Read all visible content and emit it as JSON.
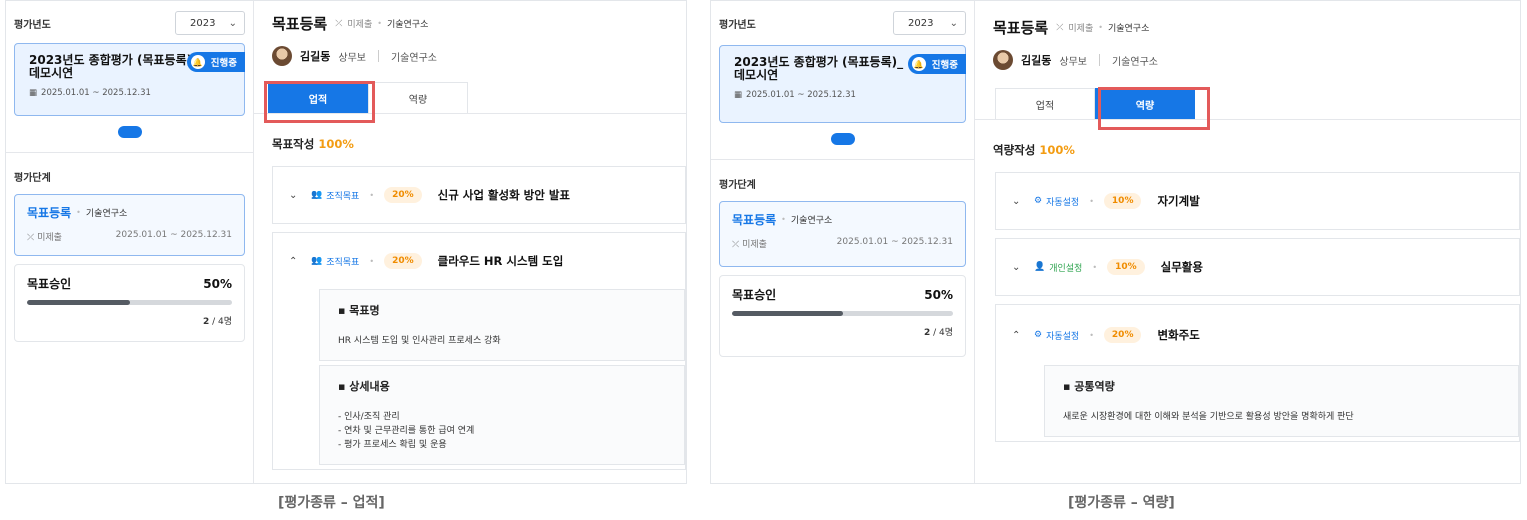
{
  "left": {
    "sidebar": {
      "year_label": "평가년도",
      "year_value": "2023",
      "eval_title": "2023년도 종합평가 (목표등록)_데모시연",
      "eval_badge": "진행중",
      "eval_period": "2025.01.01 ~ 2025.12.31",
      "stage_label": "평가단계",
      "stage_name": "목표등록",
      "stage_dept": "기술연구소",
      "stage_status": "미제출",
      "stage_period": "2025.01.01 ~ 2025.12.31",
      "approve_name": "목표승인",
      "approve_pct": "50%",
      "approve_progress": 0.5,
      "approve_done": "2",
      "approve_total": "/ 4명"
    },
    "main": {
      "title": "목표등록",
      "status": "미제출",
      "dept": "기술연구소",
      "user_name": "김길동",
      "user_rank": "상무보",
      "user_dept": "기술연구소",
      "tab1": "업적",
      "tab2": "역량",
      "section_title": "목표작성",
      "section_pct": "100%",
      "goals": [
        {
          "kind": "조직목표",
          "pct": "20%",
          "name": "신규 사업 활성화 방안 발표"
        },
        {
          "kind": "조직목표",
          "pct": "20%",
          "name": "클라우드 HR 시스템 도입"
        }
      ],
      "detail1_title": "목표명",
      "detail1_body": "HR 시스템 도입 및 인사관리 프로세스 강화",
      "detail2_title": "상세내용",
      "detail2_lines": [
        "- 인사/조직 관리",
        "- 연차 및 근무관리를 통한 급여 연계",
        "- 평가 프로세스 확립 및 운용"
      ]
    },
    "caption": "[평가종류 – 업적]"
  },
  "right": {
    "sidebar": {
      "year_label": "평가년도",
      "year_value": "2023",
      "eval_title": "2023년도 종합평가 (목표등록)_데모시연",
      "eval_badge": "진행중",
      "eval_period": "2025.01.01 ~ 2025.12.31",
      "stage_label": "평가단계",
      "stage_name": "목표등록",
      "stage_dept": "기술연구소",
      "stage_status": "미제출",
      "stage_period": "2025.01.01 ~ 2025.12.31",
      "approve_name": "목표승인",
      "approve_pct": "50%",
      "approve_progress": 0.5,
      "approve_done": "2",
      "approve_total": "/ 4명"
    },
    "main": {
      "title": "목표등록",
      "status": "미제출",
      "dept": "기술연구소",
      "user_name": "김길동",
      "user_rank": "상무보",
      "user_dept": "기술연구소",
      "tab1": "업적",
      "tab2": "역량",
      "section_title": "역량작성",
      "section_pct": "100%",
      "goals": [
        {
          "kind": "자동설정",
          "pct": "10%",
          "name": "자기계발"
        },
        {
          "kind": "개인설정",
          "pct": "10%",
          "name": "실무활용"
        },
        {
          "kind": "자동설정",
          "pct": "20%",
          "name": "변화주도"
        }
      ],
      "detail1_title": "공통역량",
      "detail1_body": "새로운 시장환경에 대한 이해와 분석을 기반으로 활용성 방안을 명확하게 판단"
    },
    "caption": "[평가종류 – 역량]"
  },
  "colors": {
    "accent": "#1677e6",
    "highlight": "#e35a5a",
    "percent": "#f39c12",
    "green": "#2ea44f"
  },
  "icons": [
    "bell-icon",
    "calendar-icon",
    "no-submit-icon",
    "people-icon",
    "auto-setting-icon",
    "person-icon",
    "chevron-down-icon",
    "chevron-up-icon"
  ]
}
